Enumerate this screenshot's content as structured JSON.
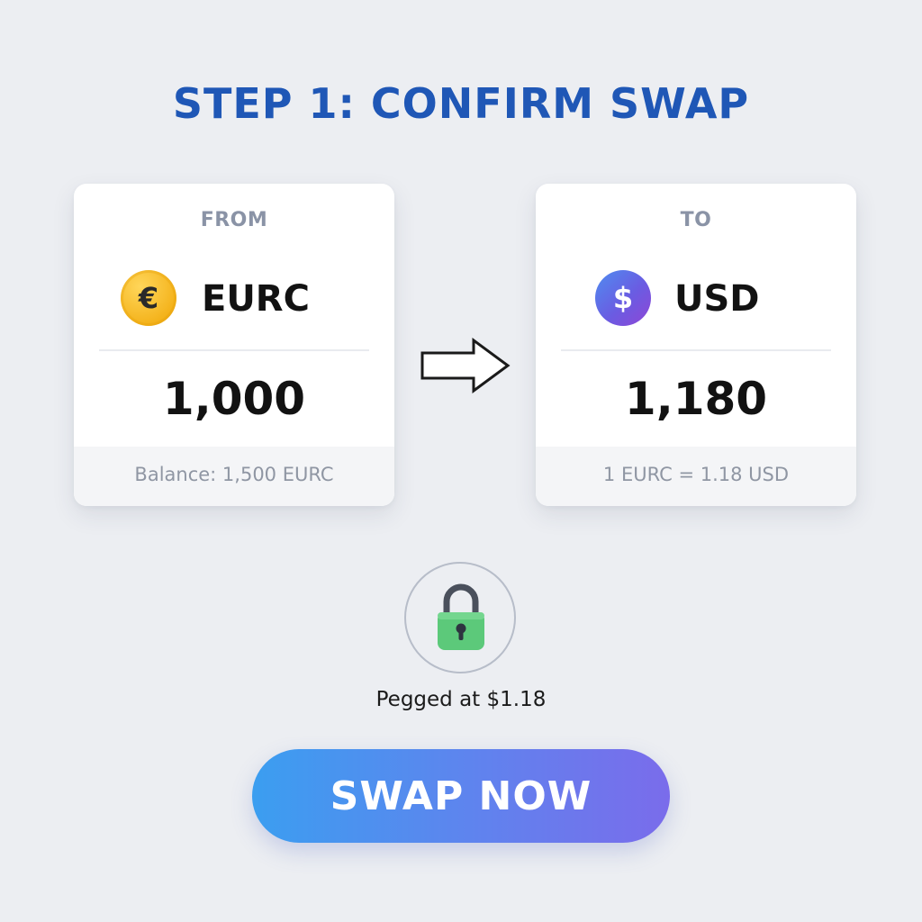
{
  "header": {
    "title": "STEP 1: CONFIRM SWAP"
  },
  "from_card": {
    "label": "FROM",
    "currency": "EURC",
    "coin_symbol": "€",
    "icon": "euro-coin-icon",
    "amount": "1,000",
    "footer": "Balance: 1,500 EURC"
  },
  "to_card": {
    "label": "TO",
    "currency": "USD",
    "coin_symbol": "$",
    "icon": "dollar-coin-icon",
    "amount": "1,180",
    "footer": "1 EURC = 1.18 USD"
  },
  "arrow_icon": "right-arrow-icon",
  "lock": {
    "icon": "lock-icon",
    "text": "Pegged at $1.18"
  },
  "swap_button": {
    "label": "SWAP NOW"
  },
  "colors": {
    "background": "#eceef2",
    "title": "#1f57b6",
    "button_start": "#3b9ef0",
    "button_end": "#7a6ceb",
    "lock_green": "#5cc97a"
  }
}
